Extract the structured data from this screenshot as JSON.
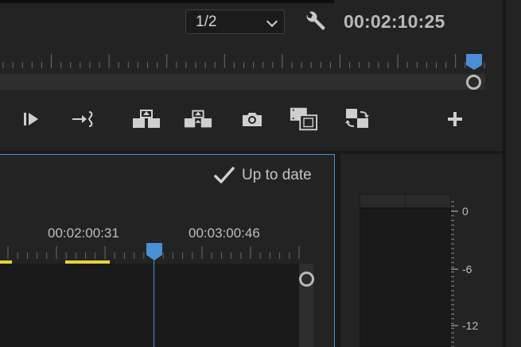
{
  "monitor": {
    "zoom_select": {
      "value": "1/2"
    },
    "timecode": "00:02:10:25"
  },
  "toolbar": {
    "buttons": [
      {
        "name": "play-in-to-out",
        "icon": "play-in-out-icon"
      },
      {
        "name": "go-to-out",
        "icon": "go-to-out-icon"
      },
      {
        "name": "lift",
        "icon": "lift-icon"
      },
      {
        "name": "extract",
        "icon": "extract-icon"
      },
      {
        "name": "export-frame",
        "icon": "camera-icon"
      },
      {
        "name": "comparison-view",
        "icon": "comparison-view-icon"
      },
      {
        "name": "toggle-proxies",
        "icon": "toggle-proxies-icon"
      },
      {
        "name": "button-editor",
        "icon": "plus-icon"
      }
    ]
  },
  "program": {
    "status": "Up to date",
    "ruler": {
      "labels": [
        "00:02:00:31",
        "00:03:00:46"
      ]
    }
  },
  "audio_meter": {
    "scale_labels": [
      "0",
      "-6",
      "-12"
    ]
  },
  "colors": {
    "accent": "#4a8fd5",
    "in_out_marker": "#e6d43a",
    "background": "#232323"
  }
}
